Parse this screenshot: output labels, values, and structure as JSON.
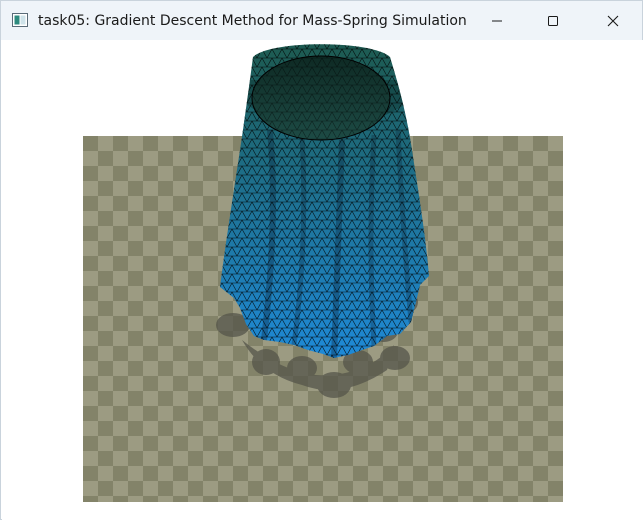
{
  "window": {
    "title": "task05: Gradient Descent Method for Mass-Spring Simulation"
  },
  "icons": {
    "app": "app-window-icon",
    "minimize": "minimize-icon",
    "maximize": "maximize-icon",
    "close": "close-icon"
  },
  "colors": {
    "titlebar": "#eff4f9",
    "floor_light": "#9c9b82",
    "floor_dark": "#838369",
    "cloth_top": "#1d5a50",
    "cloth_bottom": "#1e8ad8",
    "shadow": "#55554a"
  }
}
